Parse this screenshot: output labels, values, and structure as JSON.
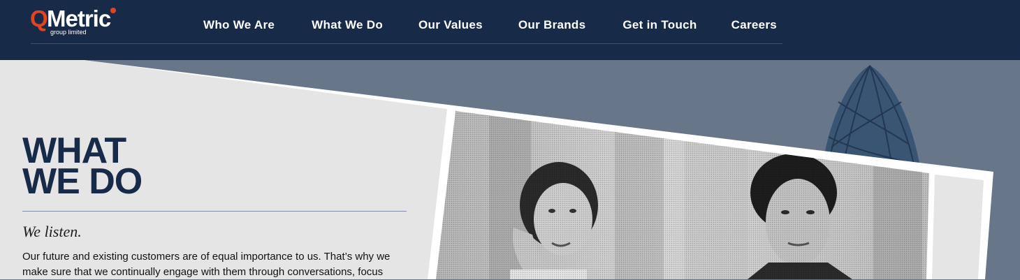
{
  "brand": {
    "logo_q": "Q",
    "logo_rest": "Metric",
    "logo_tagline": "group limited"
  },
  "nav": {
    "items": [
      {
        "label": "Who We Are"
      },
      {
        "label": "What We Do"
      },
      {
        "label": "Our Values"
      },
      {
        "label": "Our Brands"
      },
      {
        "label": "Get in Touch"
      },
      {
        "label": "Careers"
      }
    ]
  },
  "hero": {
    "title_line1": "WHAT",
    "title_line2": "WE DO",
    "subhead": "We listen.",
    "body": "Our future and existing customers are of equal importance to us. That’s why we make sure that we continually engage with them through conversations, focus"
  },
  "colors": {
    "header_bg": "#172b48",
    "accent_orange": "#e2441f",
    "hero_bg": "#68768a",
    "panel_bg": "#e6e5e6",
    "title_navy": "#172b48"
  },
  "icons": [
    "logo-mark",
    "building-illustration",
    "people-photo"
  ]
}
